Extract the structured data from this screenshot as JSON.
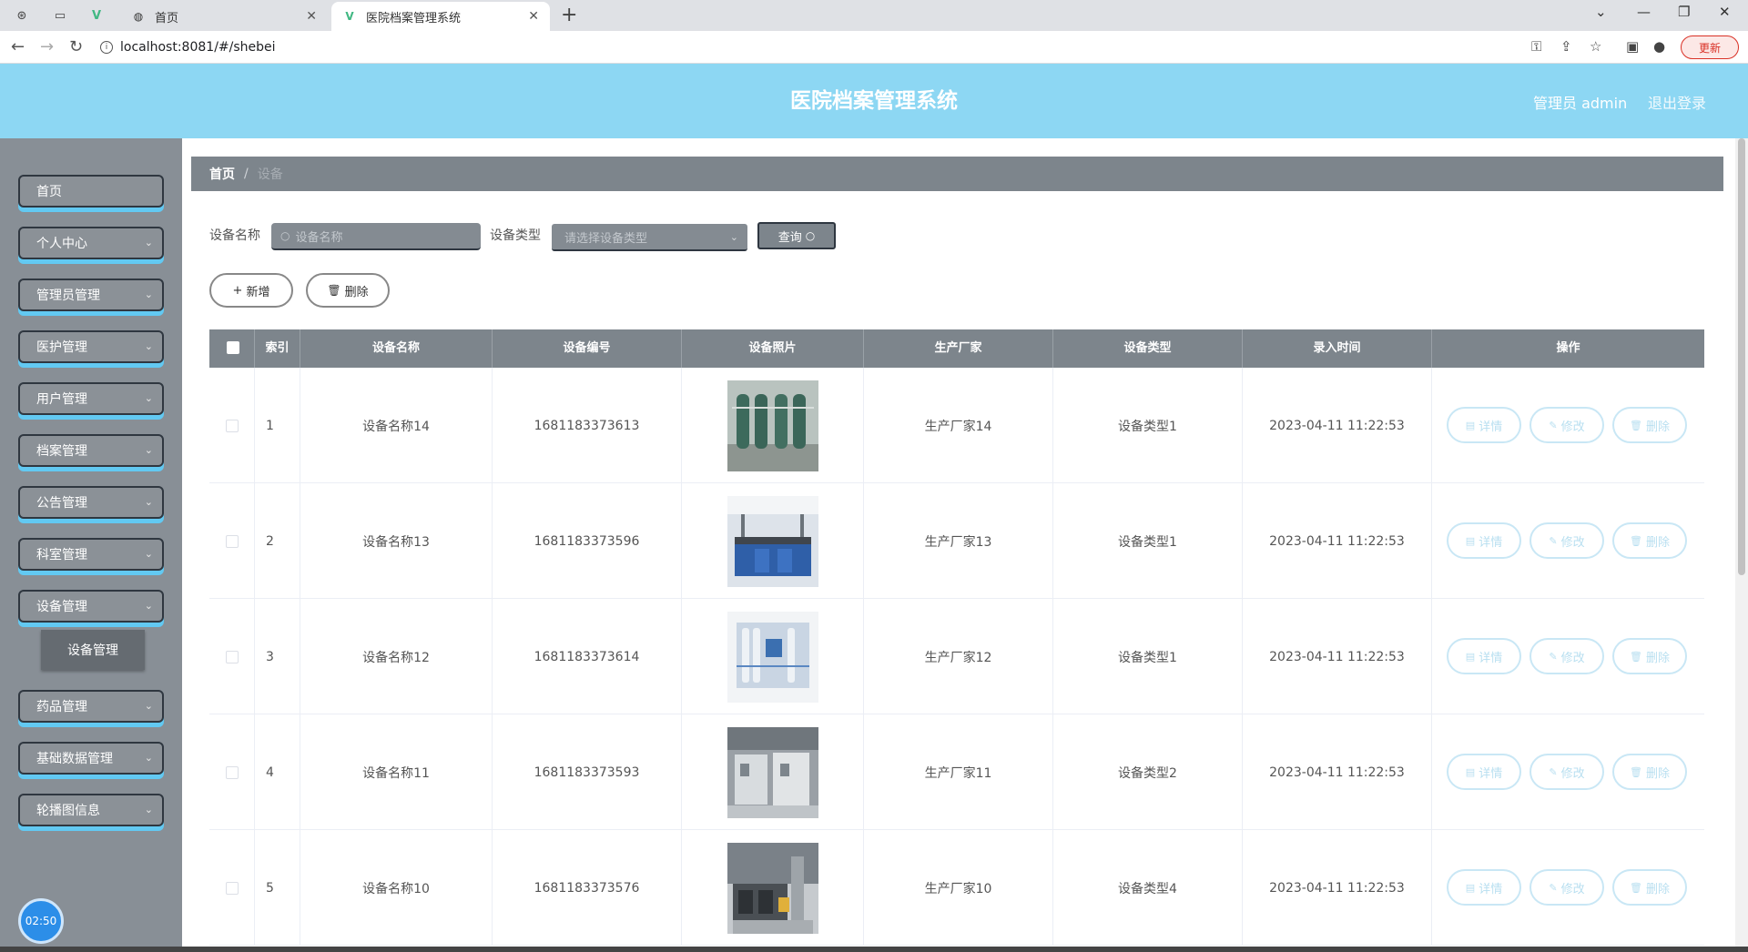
{
  "browser": {
    "tabs": [
      {
        "label": "首页",
        "active": false
      },
      {
        "label": "医院档案管理系统",
        "active": true
      }
    ],
    "url": "localhost:8081/#/shebei",
    "update_label": "更新"
  },
  "header": {
    "title": "医院档案管理系统",
    "user": "管理员 admin",
    "logout": "退出登录"
  },
  "sidebar": {
    "items": [
      {
        "label": "首页"
      },
      {
        "label": "个人中心"
      },
      {
        "label": "管理员管理"
      },
      {
        "label": "医护管理"
      },
      {
        "label": "用户管理"
      },
      {
        "label": "档案管理"
      },
      {
        "label": "公告管理"
      },
      {
        "label": "科室管理"
      },
      {
        "label": "设备管理"
      },
      {
        "label": "药品管理"
      },
      {
        "label": "基础数据管理"
      },
      {
        "label": "轮播图信息"
      }
    ],
    "submenu": {
      "label": "设备管理"
    },
    "clock": "02:50"
  },
  "breadcrumb": {
    "home": "首页",
    "separator": "/",
    "current": "设备"
  },
  "search": {
    "name_label": "设备名称",
    "name_placeholder": "设备名称",
    "type_label": "设备类型",
    "type_placeholder": "请选择设备类型",
    "query_label": "查询"
  },
  "actions": {
    "add_label": "新增",
    "delete_label": "删除"
  },
  "table": {
    "columns": [
      "索引",
      "设备名称",
      "设备编号",
      "设备照片",
      "生产厂家",
      "设备类型",
      "录入时间",
      "操作"
    ],
    "row_actions": {
      "detail": "详情",
      "edit": "修改",
      "delete": "删除"
    },
    "rows": [
      {
        "index": "1",
        "name": "设备名称14",
        "code": "1681183373613",
        "maker": "生产厂家14",
        "type": "设备类型1",
        "time": "2023-04-11 11:22:53"
      },
      {
        "index": "2",
        "name": "设备名称13",
        "code": "1681183373596",
        "maker": "生产厂家13",
        "type": "设备类型1",
        "time": "2023-04-11 11:22:53"
      },
      {
        "index": "3",
        "name": "设备名称12",
        "code": "1681183373614",
        "maker": "生产厂家12",
        "type": "设备类型1",
        "time": "2023-04-11 11:22:53"
      },
      {
        "index": "4",
        "name": "设备名称11",
        "code": "1681183373593",
        "maker": "生产厂家11",
        "type": "设备类型2",
        "time": "2023-04-11 11:22:53"
      },
      {
        "index": "5",
        "name": "设备名称10",
        "code": "1681183373576",
        "maker": "生产厂家10",
        "type": "设备类型4",
        "time": "2023-04-11 11:22:53"
      }
    ]
  },
  "colors": {
    "header_bg": "#8dd7f3",
    "sidebar_bg": "#888f96",
    "accent_underline": "#62c9f2",
    "table_head_bg": "#7d858c"
  }
}
